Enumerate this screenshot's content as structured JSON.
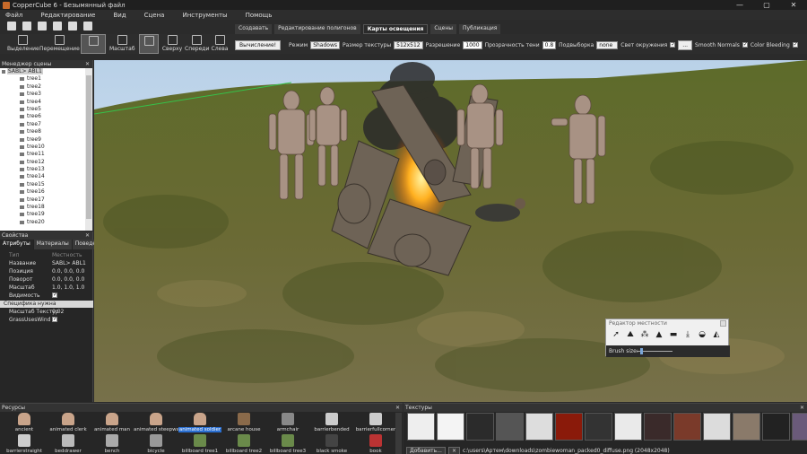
{
  "window": {
    "title": "CopperCube 6 - Безымянный файл"
  },
  "menu": [
    "Файл",
    "Редактирование",
    "Вид",
    "Сцена",
    "Инструменты",
    "Помощь"
  ],
  "tools": [
    {
      "label": "Выделение"
    },
    {
      "label": "Перемещение"
    },
    {
      "label": "Вращение"
    },
    {
      "label": "Масштаб"
    },
    {
      "label": "3D"
    },
    {
      "label": "Сверху"
    },
    {
      "label": "Спереди"
    },
    {
      "label": "Слева"
    }
  ],
  "ribbon_tabs": [
    "Создавать",
    "Редактирование полигонов",
    "Карты освещения",
    "Сцены",
    "Публикация"
  ],
  "ribbon": {
    "compute_button": "Вычисление!",
    "mode_label": "Режим",
    "mode_value": "Shadows",
    "texsize_label": "Размер текстуры",
    "texsize_value": "512x512",
    "resolution_label": "Разрешение",
    "resolution_value": "1000",
    "shadow_opacity_label": "Прозрачность тени",
    "shadow_opacity_value": "0.8",
    "sampling_label": "Подвыборка",
    "sampling_value": "none",
    "ambient_label": "Свет окружения",
    "ambient_btn": "...",
    "smooth_label": "Smooth Normals",
    "bleeding_label": "Color Bleeding"
  },
  "scene_manager": {
    "title": "Менеджер сцены",
    "root": "SABL> ABL1",
    "items": [
      "tree1",
      "tree2",
      "tree3",
      "tree4",
      "tree5",
      "tree6",
      "tree7",
      "tree8",
      "tree9",
      "tree10",
      "tree11",
      "tree12",
      "tree13",
      "tree14",
      "tree15",
      "tree16",
      "tree17",
      "tree18",
      "tree19",
      "tree20"
    ]
  },
  "properties": {
    "title": "Свойства",
    "tabs": [
      "Атрибуты",
      "Материалы",
      "Поведение"
    ],
    "rows": [
      {
        "k": "Тип",
        "v": "Местность",
        "grey": true
      },
      {
        "k": "Название",
        "v": "SABL> ABL1"
      },
      {
        "k": "Позиция",
        "v": "0.0, 0.0, 0.0"
      },
      {
        "k": "Поворот",
        "v": "0.0, 0.0, 0.0"
      },
      {
        "k": "Масштаб",
        "v": "1.0, 1.0, 1.0"
      },
      {
        "k": "Видимость",
        "v": ""
      }
    ],
    "group": "Специфика нужна",
    "group_rows": [
      {
        "k": "Масштаб Текстур",
        "v": "0.02"
      },
      {
        "k": "GrassUsesWind",
        "v": ""
      }
    ]
  },
  "terrain_editor": {
    "title": "Редактор местности",
    "brush_label": "Brush size:",
    "brush_size": 0.1
  },
  "resources": {
    "title": "Ресурсы",
    "items": [
      {
        "label": "ancient",
        "icon": "person-icon"
      },
      {
        "label": "animated clerk",
        "icon": "person-icon"
      },
      {
        "label": "animated man",
        "icon": "person-icon"
      },
      {
        "label": "animated steepwalker",
        "icon": "person-icon"
      },
      {
        "label": "animated soldier",
        "icon": "person-icon",
        "selected": true
      },
      {
        "label": "arcane house",
        "icon": "house-icon"
      },
      {
        "label": "armchair",
        "icon": "chair-icon"
      },
      {
        "label": "barrierbended",
        "icon": "barrier-icon"
      },
      {
        "label": "barrierfullcorner",
        "icon": "barrier-icon"
      },
      {
        "label": "barrierstraight",
        "icon": "barrier-icon"
      },
      {
        "label": "beddrawer",
        "icon": "bed-icon"
      },
      {
        "label": "bench",
        "icon": "bench-icon"
      },
      {
        "label": "bicycle",
        "icon": "bike-icon"
      },
      {
        "label": "billboard tree1",
        "icon": "tree-icon"
      },
      {
        "label": "billboard tree2",
        "icon": "tree-icon"
      },
      {
        "label": "billboard tree3",
        "icon": "tree-icon"
      },
      {
        "label": "black smoke",
        "icon": "smoke-icon"
      },
      {
        "label": "book",
        "icon": "book-icon"
      }
    ]
  },
  "textures": {
    "title": "Текстуры",
    "add_button": "Добавить...",
    "remove_button": "×",
    "path": "c:\\users\\Артем\\downloads\\zombiewoman_packed0_diffuse.png (2048x2048)"
  }
}
